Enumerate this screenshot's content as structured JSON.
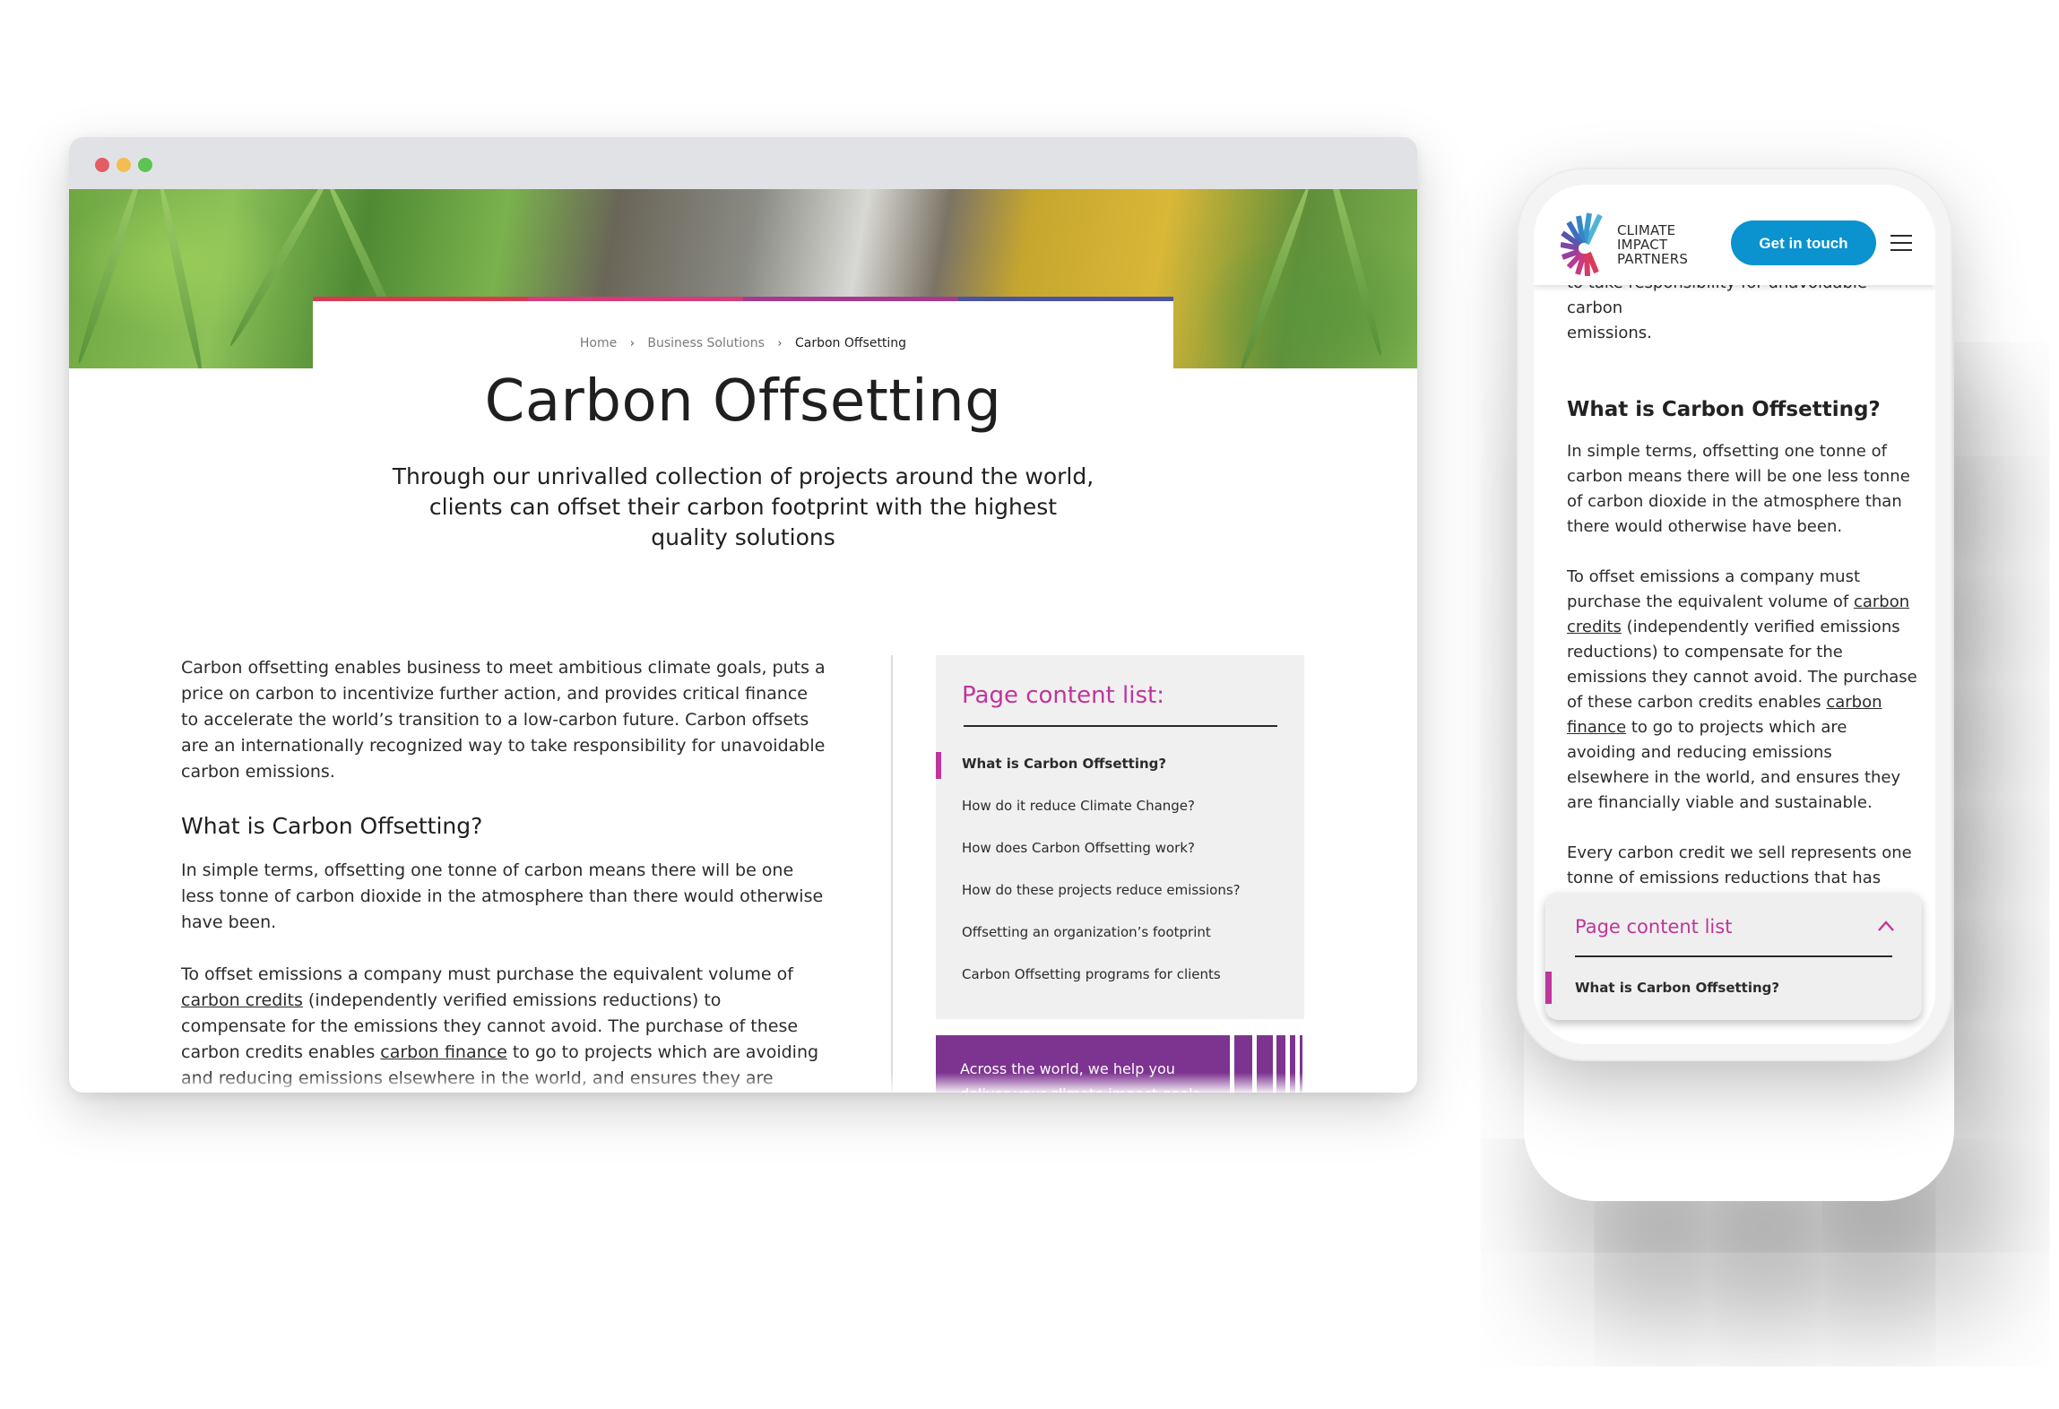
{
  "colors": {
    "accent_magenta": "#c0359b",
    "promo_purple": "#7d3490",
    "cta_blue": "#0a93cf",
    "gradient_bar": [
      "#d93a4f",
      "#d63b7a",
      "#a43a8e",
      "#4a54a0"
    ]
  },
  "desktop": {
    "window_controls": [
      "close",
      "minimize",
      "maximize"
    ],
    "breadcrumb": {
      "items": [
        "Home",
        "Business Solutions",
        "Carbon Offsetting"
      ],
      "separator_icon": "chevron-right-icon"
    },
    "title": "Carbon Offsetting",
    "subtitle": "Through our unrivalled collection of projects around the world, clients can offset their carbon footprint with the highest quality solutions",
    "intro": "Carbon offsetting enables business to meet ambitious climate goals, puts a price on carbon to incentivize further action, and provides critical finance to accelerate the world’s transition to a low-carbon future. Carbon offsets are an internationally recognized way to take responsibility for unavoidable carbon emissions.",
    "section_heading": "What is Carbon Offsetting?",
    "para1": "In simple terms, offsetting one tonne of carbon means there will be one less tonne of carbon dioxide in the atmosphere than there would otherwise have been.",
    "para2": {
      "part1": "To offset emissions a company must purchase the equivalent volume of ",
      "link1": "carbon credits",
      "part2": " (independently verified emissions reductions) to compensate for the emissions they cannot avoid. The purchase of these carbon credits enables ",
      "link2": "carbon finance",
      "part3": " to go to projects which are avoiding and reducing emissions elsewhere in the world, and ensures they are financially viable and sustainable."
    },
    "para3_partial": "Every carbon credit we sell represents one tonne of emissions reductions that has",
    "toc": {
      "title": "Page content list:",
      "items": [
        {
          "label": "What is Carbon Offsetting?",
          "active": true
        },
        {
          "label": "How do it reduce Climate Change?",
          "active": false
        },
        {
          "label": "How does Carbon Offsetting work?",
          "active": false
        },
        {
          "label": "How do these projects reduce emissions?",
          "active": false
        },
        {
          "label": "Offsetting an organization’s footprint",
          "active": false
        },
        {
          "label": "Carbon Offsetting programs for clients",
          "active": false
        }
      ]
    },
    "promo": {
      "line1": "Across the world, we help you",
      "line2_partial": "deliver your climate impact goals"
    }
  },
  "mobile": {
    "logo": {
      "line1": "CLIMATE",
      "line2": "IMPACT",
      "line3": "PARTNERS"
    },
    "cta_label": "Get in touch",
    "menu_icon": "hamburger-icon",
    "cut_line": "to take responsibility for unavoidable carbon",
    "emissions_line": "emissions.",
    "section_heading": "What is Carbon Offsetting?",
    "para1": "In simple terms, offsetting one tonne of carbon means there will be one less tonne of carbon dioxide in the atmosphere than there would otherwise have been.",
    "para2": {
      "part1": "To offset emissions a company must purchase the equivalent volume of ",
      "link1": "carbon credits",
      "part2": " (independently verified emissions reductions) to compensate for the emissions they cannot avoid. The purchase of these carbon credits enables ",
      "link2": "carbon finance",
      "part3": " to go to projects which are avoiding and reducing emissions elsewhere in the world, and ensures they are financially viable and sustainable."
    },
    "para3": "Every carbon credit we sell represents one tonne of emissions reductions that has been delivered by a project, and is independently verified and unique.",
    "toc": {
      "title": "Page content list",
      "toggle_icon": "chevron-up-icon",
      "active_item": "What is Carbon Offsetting?"
    }
  }
}
